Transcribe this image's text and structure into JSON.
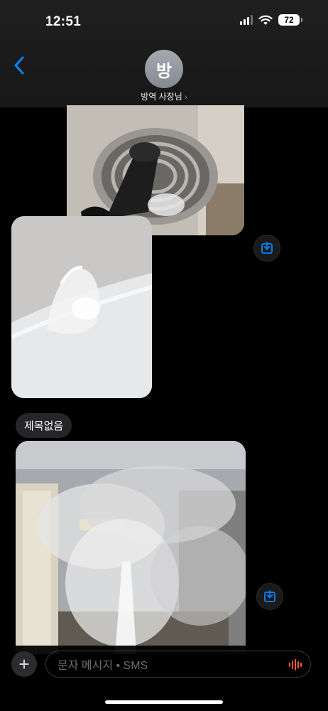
{
  "status": {
    "time": "12:51",
    "battery": "72"
  },
  "header": {
    "avatar_initial": "방",
    "contact_name": "방역 사장님",
    "chevron": "›"
  },
  "messages": {
    "subject_bubble": "제목없음"
  },
  "composer": {
    "placeholder": "문자 메시지 • SMS",
    "plus": "+"
  },
  "colors": {
    "accent": "#0a84ff",
    "background": "#000000",
    "bubble": "#262629"
  },
  "icons": {
    "back": "chevron-left-icon",
    "save": "download-icon",
    "mic": "waveform-icon",
    "wifi": "wifi-icon",
    "signal": "signal-icon"
  }
}
